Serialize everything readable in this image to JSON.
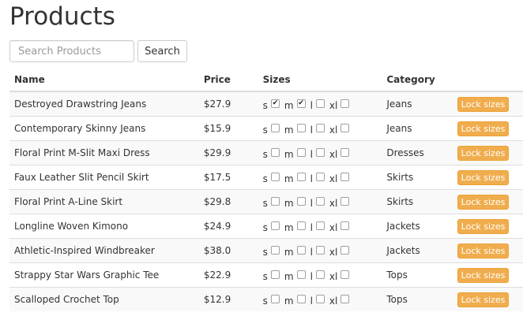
{
  "page": {
    "title": "Products"
  },
  "search": {
    "placeholder": "Search Products",
    "value": "",
    "button_label": "Search"
  },
  "table": {
    "headers": {
      "name": "Name",
      "price": "Price",
      "sizes": "Sizes",
      "category": "Category"
    },
    "size_labels": [
      "s",
      "m",
      "l",
      "xl"
    ],
    "action_label": "Lock sizes",
    "rows": [
      {
        "name": "Destroyed Drawstring Jeans",
        "price": "$27.9",
        "sizes": [
          true,
          true,
          false,
          false
        ],
        "category": "Jeans"
      },
      {
        "name": "Contemporary Skinny Jeans",
        "price": "$15.9",
        "sizes": [
          false,
          false,
          false,
          false
        ],
        "category": "Jeans"
      },
      {
        "name": "Floral Print M-Slit Maxi Dress",
        "price": "$29.9",
        "sizes": [
          false,
          false,
          false,
          false
        ],
        "category": "Dresses"
      },
      {
        "name": "Faux Leather Slit Pencil Skirt",
        "price": "$17.5",
        "sizes": [
          false,
          false,
          false,
          false
        ],
        "category": "Skirts"
      },
      {
        "name": "Floral Print A-Line Skirt",
        "price": "$29.8",
        "sizes": [
          false,
          false,
          false,
          false
        ],
        "category": "Skirts"
      },
      {
        "name": "Longline Woven Kimono",
        "price": "$24.9",
        "sizes": [
          false,
          false,
          false,
          false
        ],
        "category": "Jackets"
      },
      {
        "name": "Athletic-Inspired Windbreaker",
        "price": "$38.0",
        "sizes": [
          false,
          false,
          false,
          false
        ],
        "category": "Jackets"
      },
      {
        "name": "Strappy Star Wars Graphic Tee",
        "price": "$22.9",
        "sizes": [
          false,
          false,
          false,
          false
        ],
        "category": "Tops"
      },
      {
        "name": "Scalloped Crochet Top",
        "price": "$12.9",
        "sizes": [
          false,
          false,
          false,
          false
        ],
        "category": "Tops"
      }
    ]
  },
  "colors": {
    "lock_button": "#f0ad4e",
    "stripe": "#f9f9f9",
    "border": "#dddddd"
  }
}
